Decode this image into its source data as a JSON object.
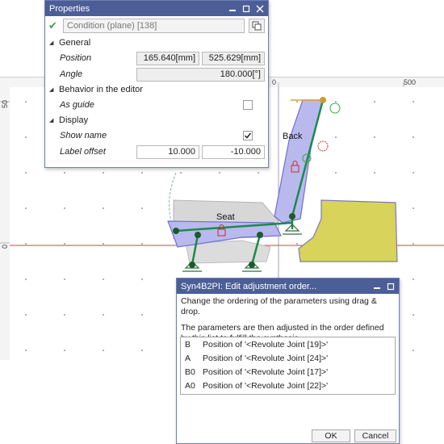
{
  "canvas": {
    "ruler_top_0": "0",
    "ruler_top_500": "500",
    "ruler_left_50": "50",
    "ruler_left_0": "0",
    "label_back": "Back",
    "label_seat": "Seat"
  },
  "properties": {
    "title": "Properties",
    "condition": "Condition (plane) [138]",
    "general": {
      "header": "General",
      "position_label": "Position",
      "position_x": "165.640[mm]",
      "position_y": "525.629[mm]",
      "angle_label": "Angle",
      "angle_value": "180.000[°]"
    },
    "behavior": {
      "header": "Behavior in the editor",
      "as_guide_label": "As guide",
      "as_guide_checked": false
    },
    "display": {
      "header": "Display",
      "show_name_label": "Show name",
      "show_name_checked": true,
      "label_offset_label": "Label offset",
      "label_offset_x": "10.000",
      "label_offset_y": "-10.000"
    }
  },
  "dialog": {
    "title": "Syn4B2PI: Edit adjustment order...",
    "instruction": "Change the ordering of the parameters using drag & drop.",
    "description": "The parameters are then adjusted in the order defined by this list to fulfill the synthesis.",
    "items": [
      {
        "key": "B",
        "text": "Position of '<Revolute Joint [19]>'"
      },
      {
        "key": "A",
        "text": "Position of '<Revolute Joint [24]>'"
      },
      {
        "key": "B0",
        "text": "Position of '<Revolute Joint [17]>'"
      },
      {
        "key": "A0",
        "text": "Position of '<Revolute Joint [22]>'"
      }
    ],
    "ok": "OK",
    "cancel": "Cancel"
  },
  "colors": {
    "titlebar": "#4c5e98",
    "accent_green": "#2f9e5a",
    "mechanism_blue": "#7b7bd8",
    "block_yellow": "#d8d35a"
  }
}
